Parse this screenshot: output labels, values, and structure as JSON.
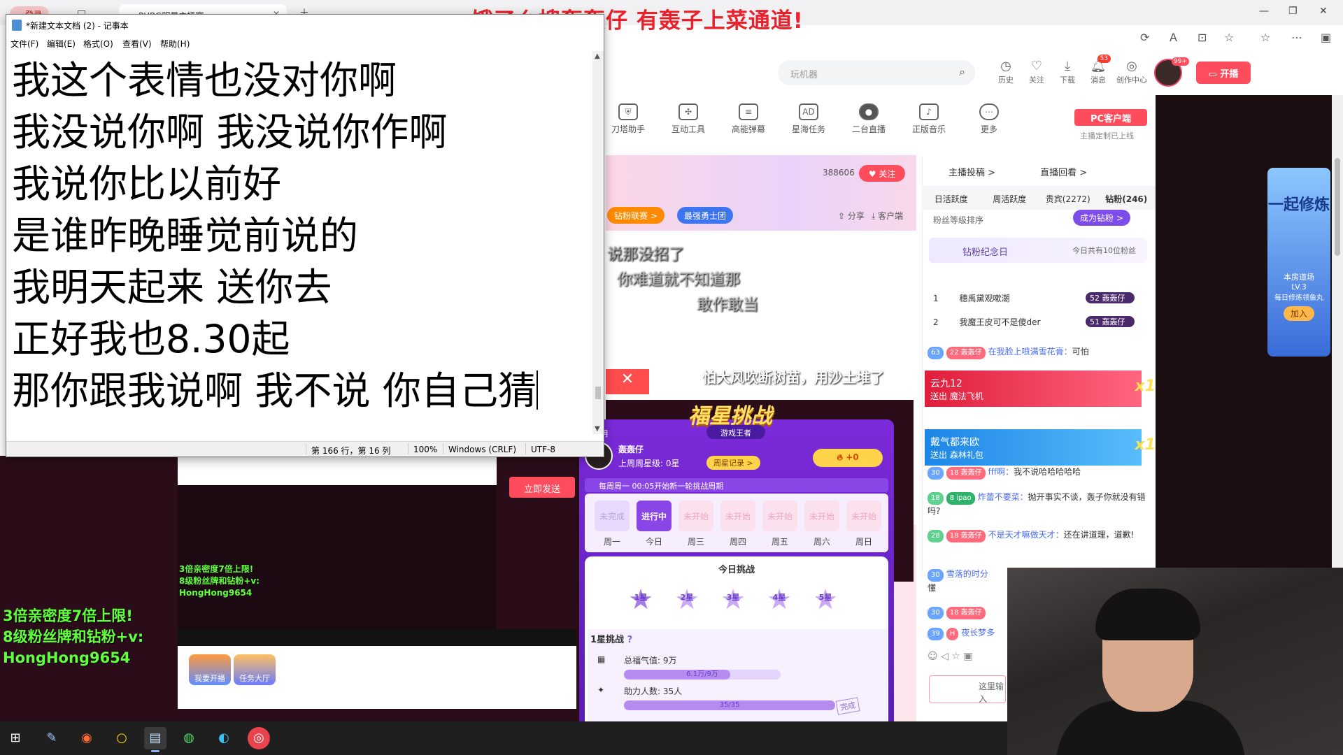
{
  "browser": {
    "tabs": [
      {
        "label": "登录"
      },
      {
        "label": "PUBG明星主播赛"
      }
    ],
    "banner_text": "饿了么搜轰轰仔 有轰子上菜通道!"
  },
  "site_header": {
    "search_placeholder": "玩机器",
    "items": [
      {
        "label": "历史",
        "icon": "history-icon"
      },
      {
        "label": "关注",
        "icon": "heart-icon"
      },
      {
        "label": "下载",
        "icon": "download-icon"
      },
      {
        "label": "消息",
        "icon": "message-icon",
        "badge": "53"
      },
      {
        "label": "创作中心",
        "icon": "bulb-icon"
      }
    ],
    "avatar_badge": "99+",
    "open_label": "开播"
  },
  "tools": [
    {
      "label": "刀塔助手"
    },
    {
      "label": "互动工具"
    },
    {
      "label": "高能弹幕"
    },
    {
      "label": "星海任务"
    },
    {
      "label": "二台直播"
    },
    {
      "label": "正版音乐"
    },
    {
      "label": "更多"
    }
  ],
  "pc_client": {
    "label": "PC客户端",
    "sub": "主播定制已上线"
  },
  "stream": {
    "follow_count": "388606",
    "follow_label": "关注",
    "pills": [
      "钻粉联赛 >",
      "最强勇士团"
    ],
    "share_label": "分享",
    "client_label": "客户端"
  },
  "side_panel": {
    "top_tabs": [
      "主播投稿 >",
      "直播回看 >"
    ],
    "tabs": [
      "日活跃度",
      "周活跃度",
      "贵宾(2272)",
      "钻粉(246)"
    ],
    "rank_label": "粉丝等级排序",
    "become_fan": "成为钻粉 >",
    "anniv_label": "钻粉纪念日",
    "anniv_right": "今日共有10位粉丝",
    "ranks": [
      {
        "no": "1",
        "name": "穗禹黛观嗽潮",
        "lvl": "52 轰轰仔"
      },
      {
        "no": "2",
        "name": "我魔王皮可不是傻der",
        "lvl": "51 轰轰仔"
      }
    ],
    "chat": [
      {
        "lv": "63",
        "tag": "22 轰轰仔",
        "name": "在我脸上喷满雪花膏：",
        "text": "可怕"
      },
      {
        "lv": "30",
        "tag": "18 轰轰仔",
        "name": "fff啊：",
        "text": "我不说哈哈哈哈哈"
      },
      {
        "lv": "18",
        "tag": "8 ipao",
        "name": "炸蕾不要菜：",
        "text": "抛开事实不谈，轰子你就没有错吗?"
      },
      {
        "lv": "28",
        "tag": "18 轰轰仔",
        "name": "不是天才嘛做天才：",
        "text": "还在讲道理，道歉!"
      },
      {
        "lv": "30",
        "tag": "",
        "name": "雪落的时分",
        "text": "懂"
      },
      {
        "lv": "30",
        "tag": "18 轰轰仔",
        "name": "",
        "text": ""
      },
      {
        "lv": "39",
        "tag": "H",
        "name": "夜长梦多",
        "text": ""
      }
    ],
    "gifts": [
      {
        "user": "云九12",
        "action": "送出",
        "gift": "魔法飞机",
        "mult": "x1"
      },
      {
        "user": "戴气都来欧",
        "action": "送出",
        "gift": "森林礼包",
        "mult": "x1"
      }
    ],
    "chat_input_placeholder": "这里输入"
  },
  "promo_card": {
    "title": "一起修炼",
    "sub1": "本房道场",
    "sub2": "LV.3",
    "sub3": "每日修炼领鱼丸",
    "join": "加入"
  },
  "fortune": {
    "title": "福星挑战",
    "subtitle": "游戏王者",
    "rules": "法说明",
    "user_name": "轰轰仔",
    "last_week": "上周周星级: 0星",
    "record_btn": "周星记录 >",
    "plus": "+0",
    "week_banner": "每周周一 00:05开始新一轮挑战周期",
    "days": [
      {
        "state": "未完成",
        "label": "周一"
      },
      {
        "state": "进行中",
        "label": "今日"
      },
      {
        "state": "未开始",
        "label": "周三"
      },
      {
        "state": "未开始",
        "label": "周四"
      },
      {
        "state": "未开始",
        "label": "周五"
      },
      {
        "state": "未开始",
        "label": "周六"
      },
      {
        "state": "未开始",
        "label": "周日"
      }
    ],
    "today_title": "今日挑战",
    "stars": [
      "1星",
      "2星",
      "3星",
      "4星",
      "5星"
    ],
    "stage_title": "1星挑战",
    "rows": [
      {
        "label": "总福气值: 9万",
        "bar_text": "6.1万/9万",
        "progress": 0.68
      },
      {
        "label": "助力人数: 35人",
        "bar_text": "35/35",
        "progress": 1.0
      }
    ],
    "done_label": "完成"
  },
  "left_area": {
    "send_label": "立即发送",
    "promo_lines": [
      "3倍亲密度7倍上限!",
      "8级粉丝牌和钻粉+v:",
      "HongHong9654"
    ],
    "dock_buttons": [
      "我要开播",
      "任务大厅"
    ]
  },
  "overlay_dialog": [
    "说那没招了",
    "你难道就不知道那",
    "敢作敢当",
    "怕大风吹断树苗，用沙土堆了"
  ],
  "notepad": {
    "title": "*新建文本文档 (2) - 记事本",
    "menu": [
      "文件(F)",
      "编辑(E)",
      "格式(O)",
      "查看(V)",
      "帮助(H)"
    ],
    "lines": [
      "我这个表情也没对你啊",
      "我没说你啊 我没说你作啊",
      "我说你比以前好",
      "是谁昨晚睡觉前说的",
      "我明天起来 送你去",
      "正好我也8.30起",
      "那你跟我说啊 我不说 你自己猜"
    ],
    "status": {
      "position": "第 166 行，第 16 列",
      "zoom": "100%",
      "eol": "Windows (CRLF)",
      "encoding": "UTF-8"
    }
  },
  "taskbar": {
    "items": [
      "windows-start-icon",
      "app-icon",
      "browser-icon",
      "circle-app-icon",
      "notepad-icon",
      "wechat-icon",
      "edge-icon",
      "netease-icon"
    ]
  }
}
